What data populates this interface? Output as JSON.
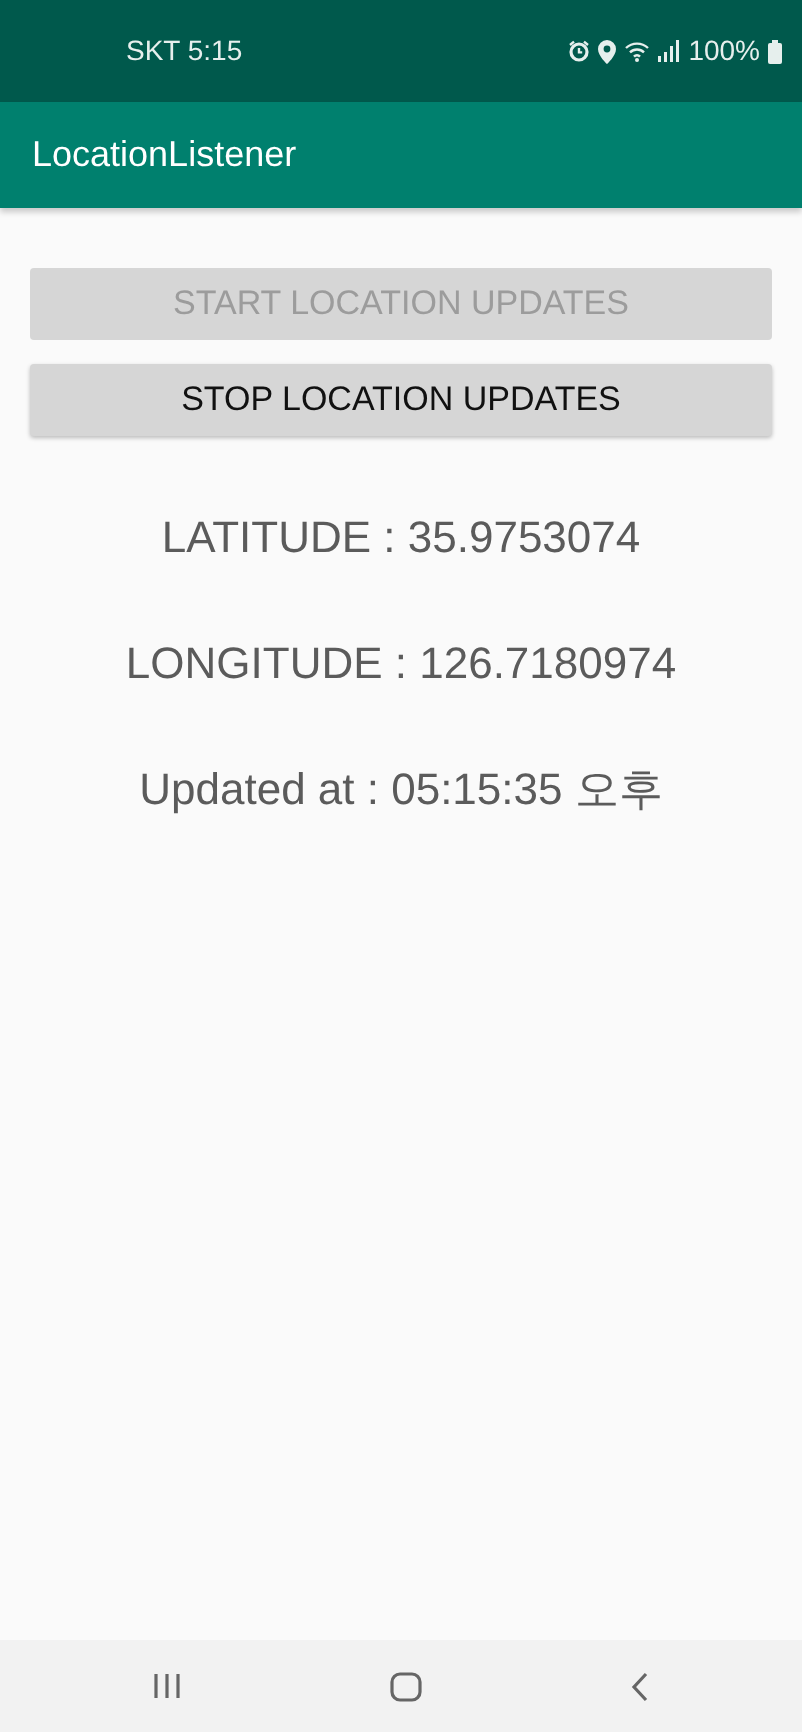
{
  "status_bar": {
    "carrier_time": "SKT 5:15",
    "battery": "100%"
  },
  "app_bar": {
    "title": "LocationListener"
  },
  "buttons": [
    {
      "label": "START LOCATION UPDATES",
      "disabled": true
    },
    {
      "label": "STOP LOCATION UPDATES",
      "disabled": false
    }
  ],
  "readings": [
    "LATITUDE : 35.9753074",
    "LONGITUDE : 126.7180974",
    "Updated at : 05:15:35 오후"
  ]
}
